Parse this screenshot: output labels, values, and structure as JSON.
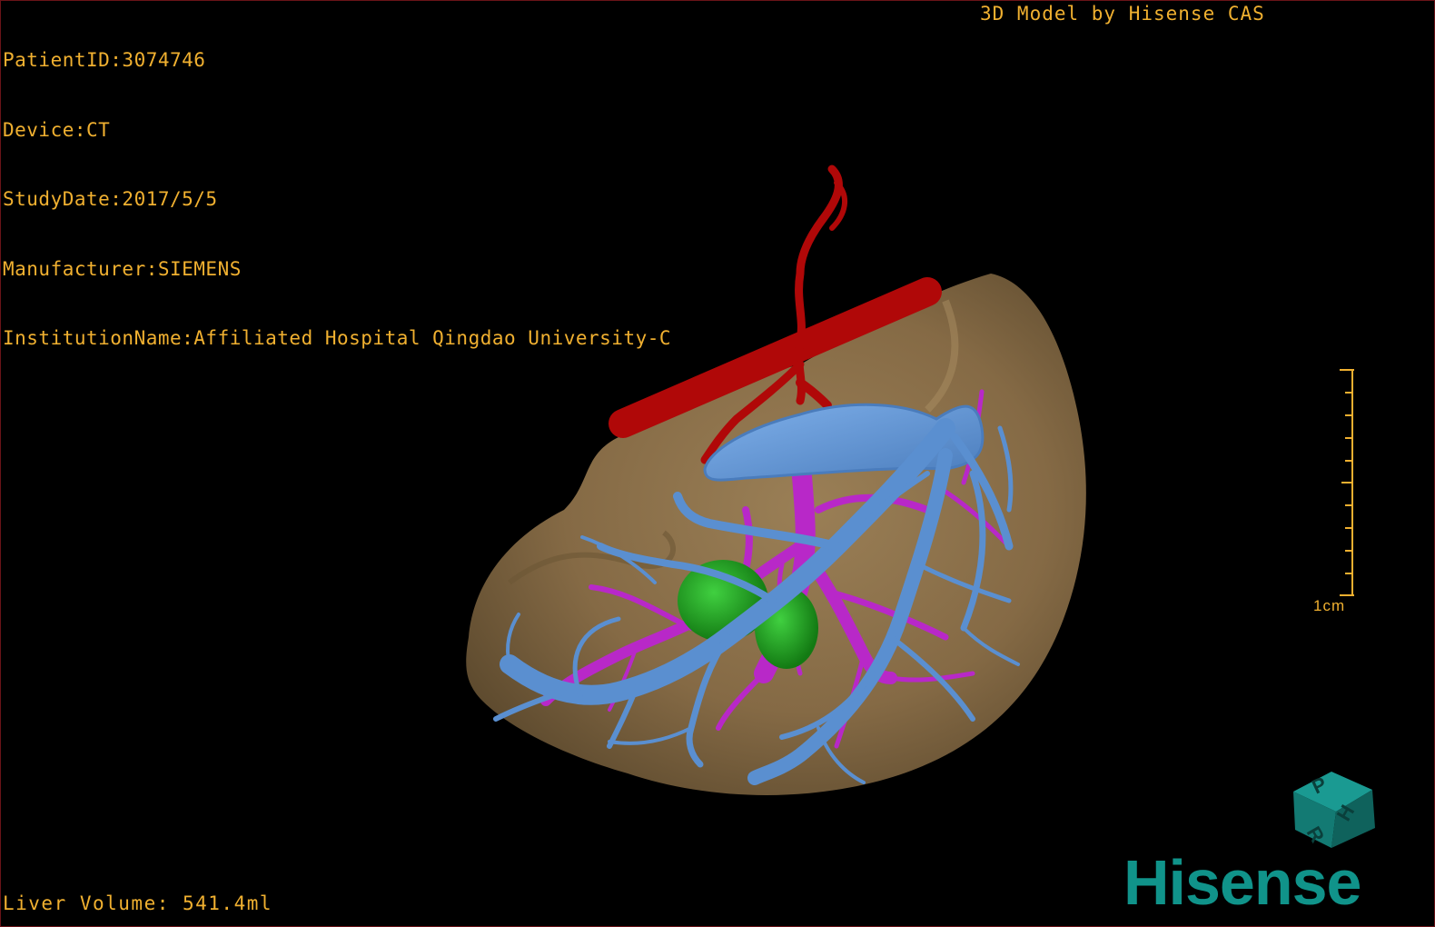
{
  "overlay": {
    "patient_id": "PatientID:3074746",
    "device": "Device:CT",
    "study_date": "StudyDate:2017/5/5",
    "manufacturer": "Manufacturer:SIEMENS",
    "institution": "InstitutionName:Affiliated Hospital Qingdao University-C",
    "model_credit": "3D Model by Hisense CAS",
    "liver_volume": "Liver Volume: 541.4ml"
  },
  "scale_bar": {
    "label": "1cm"
  },
  "orientation_cube": {
    "face_labels": [
      "P",
      "H",
      "R"
    ]
  },
  "brand": {
    "logo_text": "Hisense"
  },
  "colors": {
    "overlay_text": "#f0b030",
    "liver": "#8a7048",
    "artery": "#b00808",
    "portal_vein": "#b828c8",
    "hepatic_vein": "#5a8fd0",
    "lesion": "#20a020",
    "brand": "#10938a"
  }
}
